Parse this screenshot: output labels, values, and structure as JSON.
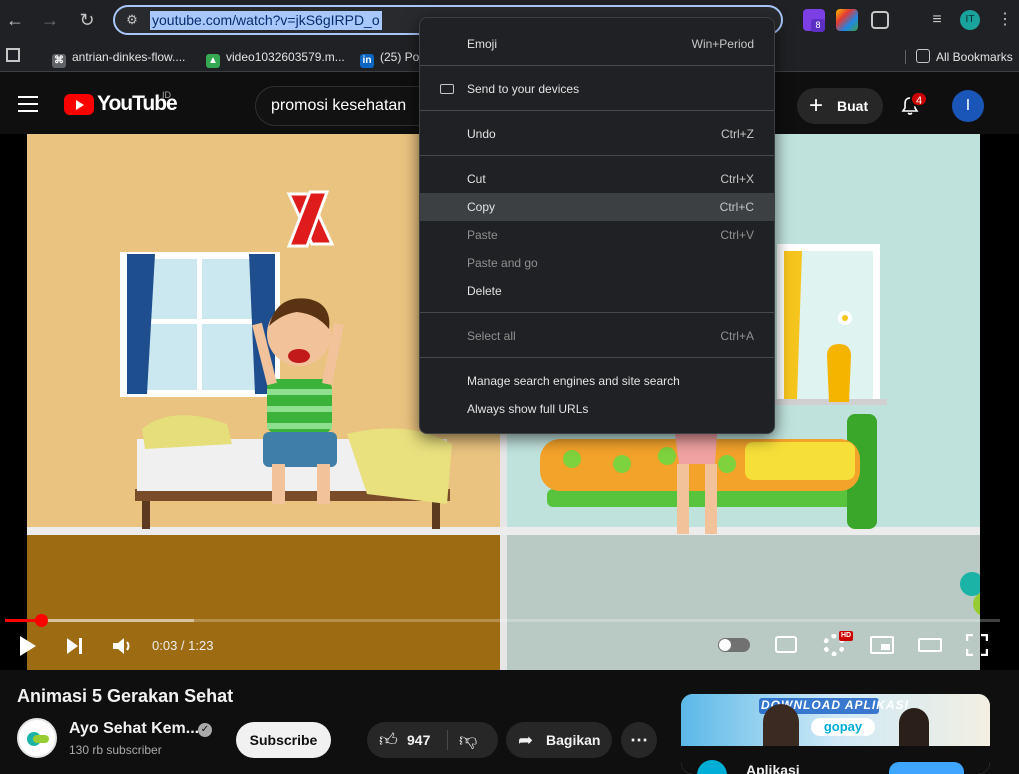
{
  "browser": {
    "url": "youtube.com/watch?v=jkS6gIRPD_o",
    "profile_initials": "IT",
    "extension_badge": "8"
  },
  "bookmarks": {
    "items": [
      {
        "label": "antrian-dinkes-flow...."
      },
      {
        "label": "video1032603579.m..."
      },
      {
        "label": "(25) Po"
      }
    ],
    "all_bookmarks": "All Bookmarks"
  },
  "youtube": {
    "logo_text": "YouTube",
    "country_code": "ID",
    "search_query": "promosi kesehatan",
    "create_label": "Buat",
    "notifications": "4",
    "avatar_letter": "I"
  },
  "player": {
    "time": "0:03 / 1:23",
    "played_fraction": 0.036,
    "loaded_fraction": 0.19,
    "quality_badge": "HD"
  },
  "video": {
    "title": "Animasi 5 Gerakan Sehat",
    "channel": "Ayo Sehat Kem...",
    "subscribers": "130 rb subscriber",
    "subscribe_label": "Subscribe",
    "likes": "947",
    "share_label": "Bagikan"
  },
  "ad": {
    "headline": "DOWNLOAD APLIKASI",
    "brand": "gopay",
    "footer_text": "Aplikasi"
  },
  "context_menu": {
    "items": [
      {
        "label": "Emoji",
        "shortcut": "Win+Period"
      },
      {
        "label": "Send to your devices",
        "shortcut": ""
      },
      {
        "label": "Undo",
        "shortcut": "Ctrl+Z"
      },
      {
        "label": "Cut",
        "shortcut": "Ctrl+X"
      },
      {
        "label": "Copy",
        "shortcut": "Ctrl+C"
      },
      {
        "label": "Paste",
        "shortcut": "Ctrl+V"
      },
      {
        "label": "Paste and go",
        "shortcut": ""
      },
      {
        "label": "Delete",
        "shortcut": ""
      },
      {
        "label": "Select all",
        "shortcut": "Ctrl+A"
      },
      {
        "label": "Manage search engines and site search",
        "shortcut": ""
      },
      {
        "label": "Always show full URLs",
        "shortcut": ""
      }
    ]
  },
  "colors": {
    "accent": "#a8c7fa",
    "youtube_red": "#ff0000",
    "menu_bg": "#202124"
  }
}
